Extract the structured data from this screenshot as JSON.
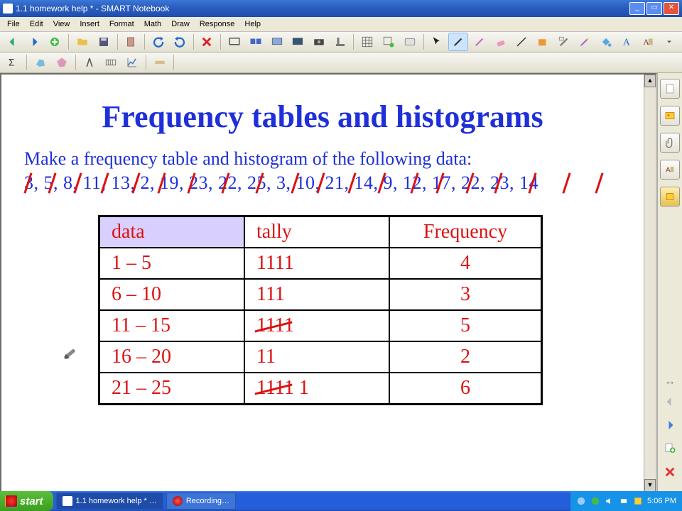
{
  "window": {
    "title": "1.1 homework help * - SMART Notebook"
  },
  "menu": [
    "File",
    "Edit",
    "View",
    "Insert",
    "Format",
    "Math",
    "Draw",
    "Response",
    "Help"
  ],
  "content": {
    "heading": "Frequency tables and histograms",
    "prompt": "Make a frequency table and histogram of the following data:",
    "raw_data": "3, 5, 8, 11, 13, 2, 19, 23, 22, 25, 3, 10, 21, 14, 9, 12, 17, 22, 23, 14"
  },
  "table": {
    "headers": {
      "c0": "data",
      "c1": "tally",
      "c2": "Frequency"
    },
    "rows": [
      {
        "range": "1 – 5",
        "tally": "1111",
        "freq": "4",
        "cross": false
      },
      {
        "range": "6 – 10",
        "tally": "111",
        "freq": "3",
        "cross": false
      },
      {
        "range": "11 – 15",
        "tally": "1111",
        "freq": "5",
        "cross": true
      },
      {
        "range": "16 – 20",
        "tally": "11",
        "freq": "2",
        "cross": false
      },
      {
        "range": "21 – 25",
        "tally": "1111 1",
        "freq": "6",
        "cross": true
      }
    ]
  },
  "taskbar": {
    "start": "start",
    "items": [
      {
        "label": "1.1 homework help * …",
        "active": true
      },
      {
        "label": "Recording…",
        "active": false
      }
    ],
    "clock": "5:06 PM"
  }
}
